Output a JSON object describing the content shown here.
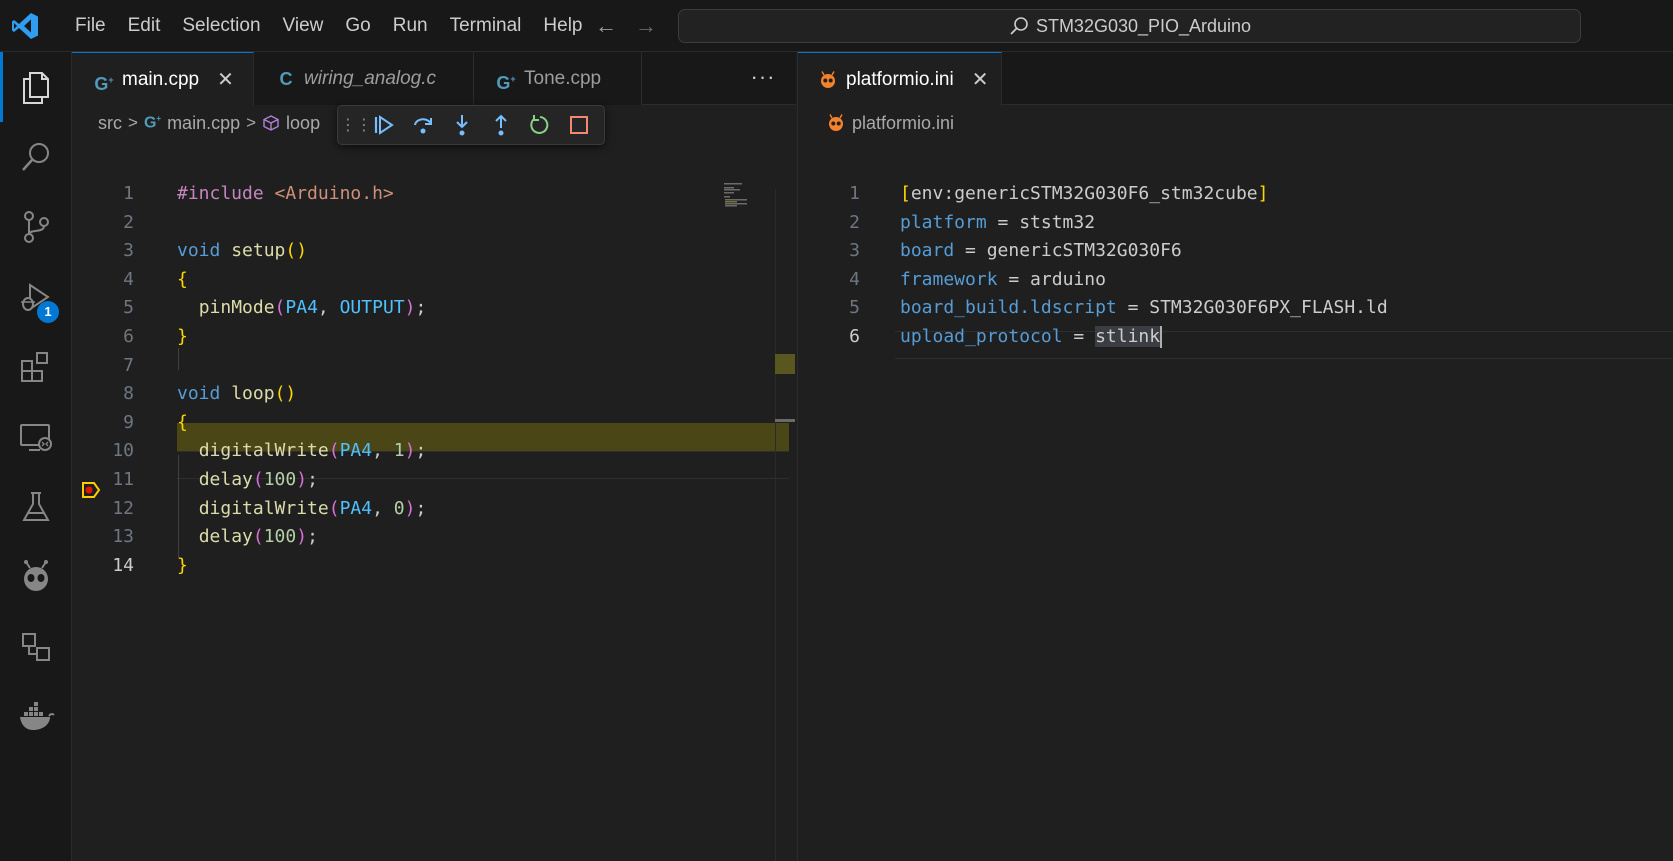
{
  "titlebar": {
    "menu": [
      "File",
      "Edit",
      "Selection",
      "View",
      "Go",
      "Run",
      "Terminal",
      "Help"
    ],
    "search_text": "STM32G030_PIO_Arduino"
  },
  "activitybar": {
    "items": [
      "explorer-icon",
      "search-icon",
      "source-control-icon",
      "run-debug-icon",
      "extensions-icon",
      "remote-explorer-icon",
      "testing-icon",
      "platformio-icon",
      "project-manager-icon",
      "docker-icon"
    ],
    "debug_badge": "1"
  },
  "left_group": {
    "tabs": [
      {
        "label": "main.cpp",
        "icon": "cpp-icon",
        "active": true,
        "italic": false
      },
      {
        "label": "wiring_analog.c",
        "icon": "c-icon",
        "active": false,
        "italic": true
      },
      {
        "label": "Tone.cpp",
        "icon": "cpp-icon",
        "active": false,
        "italic": false
      }
    ],
    "breadcrumb": {
      "folder": "src",
      "file": "main.cpp",
      "symbol": "loop"
    },
    "lines": [
      {
        "n": "1",
        "html": "<span class='pp'>#include</span> <span class='str'>&lt;Arduino.h&gt;</span>"
      },
      {
        "n": "2",
        "html": ""
      },
      {
        "n": "3",
        "html": "<span class='kw'>void</span> <span class='fn'>setup</span><span class='br1'>()</span>"
      },
      {
        "n": "4",
        "html": "<span class='br1'>{</span>"
      },
      {
        "n": "5",
        "html": "  <span class='fn'>pinMode</span><span class='br2'>(</span><span class='mac'>PA4</span>, <span class='mac'>OUTPUT</span><span class='br2'>)</span>;"
      },
      {
        "n": "6",
        "html": "<span class='br1'>}</span>"
      },
      {
        "n": "7",
        "html": ""
      },
      {
        "n": "8",
        "html": "<span class='kw'>void</span> <span class='fn'>loop</span><span class='br1'>()</span>"
      },
      {
        "n": "9",
        "html": "<span class='br1'>{</span>"
      },
      {
        "n": "10",
        "html": "  <span class='fn'>digitalWrite</span><span class='br2'>(</span><span class='mac'>PA4</span>, <span class='num'>1</span><span class='br2'>)</span>;"
      },
      {
        "n": "11",
        "html": "  <span class='fn'>delay</span><span class='br2'>(</span><span class='num'>100</span><span class='br2'>)</span>;"
      },
      {
        "n": "12",
        "html": "  <span class='fn'>digitalWrite</span><span class='br2'>(</span><span class='mac'>PA4</span>, <span class='num'>0</span><span class='br2'>)</span>;"
      },
      {
        "n": "13",
        "html": "  <span class='fn'>delay</span><span class='br2'>(</span><span class='num'>100</span><span class='br2'>)</span>;"
      },
      {
        "n": "14",
        "html": "<span class='br1'>}</span>"
      }
    ],
    "current_line": "14",
    "paused_line": "11"
  },
  "right_group": {
    "tabs": [
      {
        "label": "platformio.ini",
        "icon": "platformio-icon",
        "active": true
      }
    ],
    "breadcrumb": {
      "file": "platformio.ini"
    },
    "lines": [
      {
        "n": "1",
        "html": "<span class='br1'>[</span>env:genericSTM32G030F6_stm32cube<span class='br1'>]</span>"
      },
      {
        "n": "2",
        "html": "<span class='key'>platform</span> = ststm32"
      },
      {
        "n": "3",
        "html": "<span class='key'>board</span> = genericSTM32G030F6"
      },
      {
        "n": "4",
        "html": "<span class='key'>framework</span> = arduino"
      },
      {
        "n": "5",
        "html": "<span class='key'>board_build.ldscript</span> = STM32G030F6PX_FLASH.ld"
      },
      {
        "n": "6",
        "html": "<span class='key'>upload_protocol</span> = <span class='sel'>stlink</span><span class='cursor'></span>"
      }
    ],
    "current_line": "6"
  },
  "colors": {
    "accent": "#0078d4",
    "debug_highlight": "#4b4616",
    "platformio_orange": "#f5822a",
    "cpp_blue": "#519aba"
  }
}
